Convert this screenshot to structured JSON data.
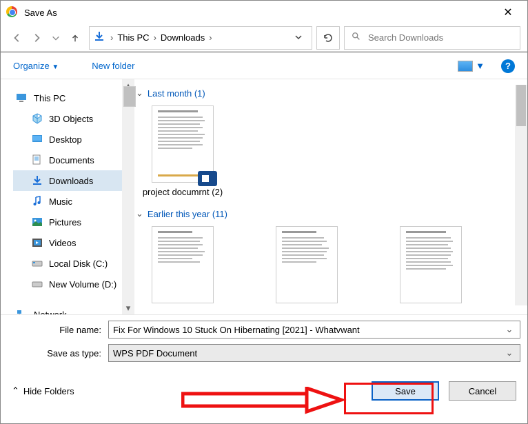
{
  "title": "Save As",
  "breadcrumb": {
    "root": "This PC",
    "folder": "Downloads"
  },
  "search_placeholder": "Search Downloads",
  "toolbar": {
    "organize": "Organize",
    "new_folder": "New folder"
  },
  "tree": {
    "this_pc": "This PC",
    "objects3d": "3D Objects",
    "desktop": "Desktop",
    "documents": "Documents",
    "downloads": "Downloads",
    "music": "Music",
    "pictures": "Pictures",
    "videos": "Videos",
    "local_c": "Local Disk (C:)",
    "new_vol": "New Volume (D:)",
    "network": "Network"
  },
  "groups": {
    "last_month": "Last month (1)",
    "earlier_year": "Earlier this year (11)"
  },
  "files": {
    "project_doc": "project documrnt (2)"
  },
  "labels": {
    "file_name": "File name:",
    "save_as_type": "Save as type:",
    "hide_folders": "Hide Folders",
    "save": "Save",
    "cancel": "Cancel"
  },
  "filename_value": "Fix For Windows 10 Stuck On Hibernating [2021] - Whatvwant",
  "save_type_value": "WPS PDF Document"
}
